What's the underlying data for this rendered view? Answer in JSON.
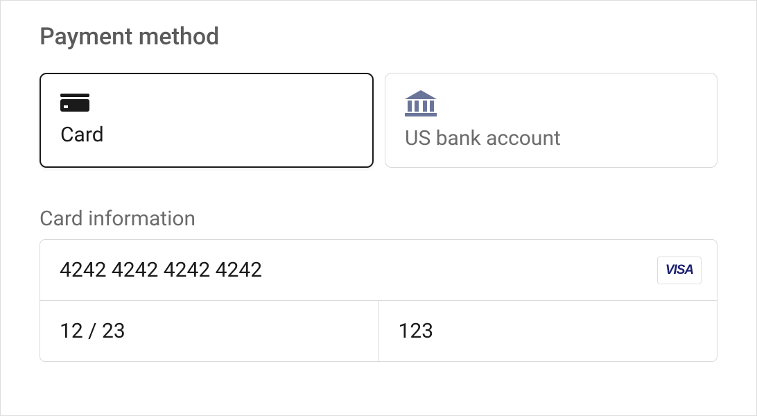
{
  "section_title": "Payment method",
  "methods": {
    "card": {
      "label": "Card",
      "selected": true
    },
    "bank": {
      "label": "US bank account",
      "selected": false
    }
  },
  "card_section": {
    "label": "Card information",
    "number": "4242 4242 4242 4242",
    "expiry": "12 / 23",
    "cvc": "123",
    "brand": "VISA"
  }
}
